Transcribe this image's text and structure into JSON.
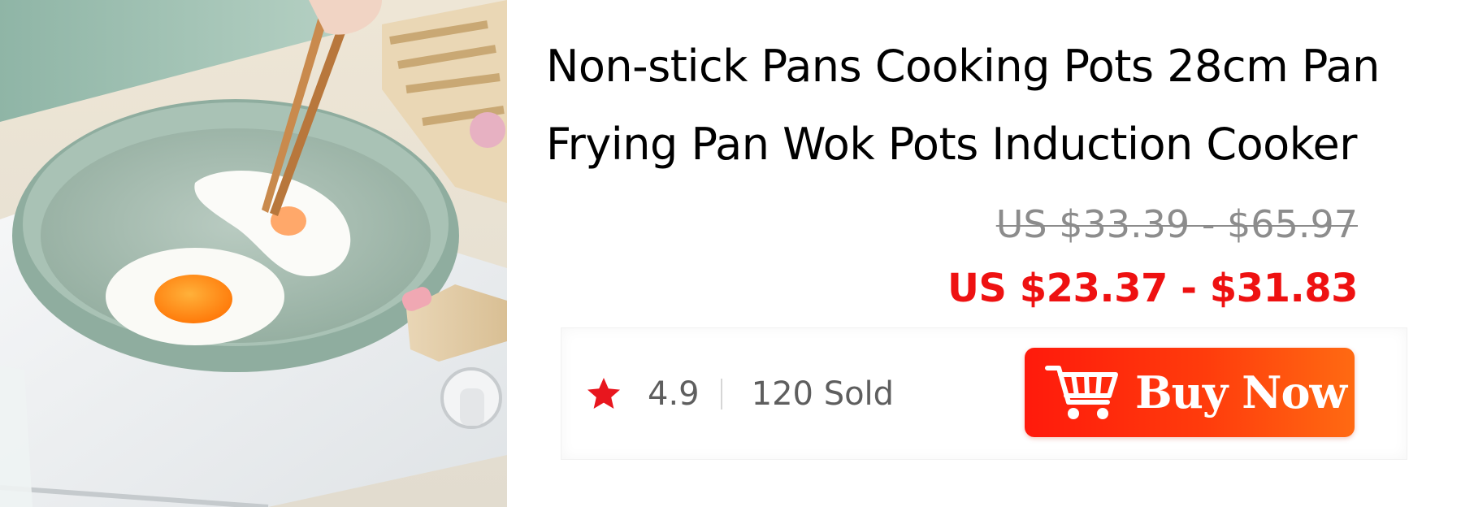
{
  "product": {
    "title_line1": "Non-stick Pans Cooking Pots 28cm Pan",
    "title_line2": "Frying Pan Wok Pots Induction Cooker",
    "original_price": "US $33.39 - $65.97",
    "sale_price": "US $23.37 - $31.83"
  },
  "stats": {
    "rating": "4.9",
    "sold": "120 Sold"
  },
  "buy_button": {
    "label": "Buy Now"
  },
  "colors": {
    "sale_price": "#ee1111",
    "star": "#e8161e",
    "button_start": "#ff1a0c",
    "button_end": "#ff6a12"
  },
  "icons": {
    "rating": "star-icon",
    "buy": "shopping-cart-icon"
  }
}
